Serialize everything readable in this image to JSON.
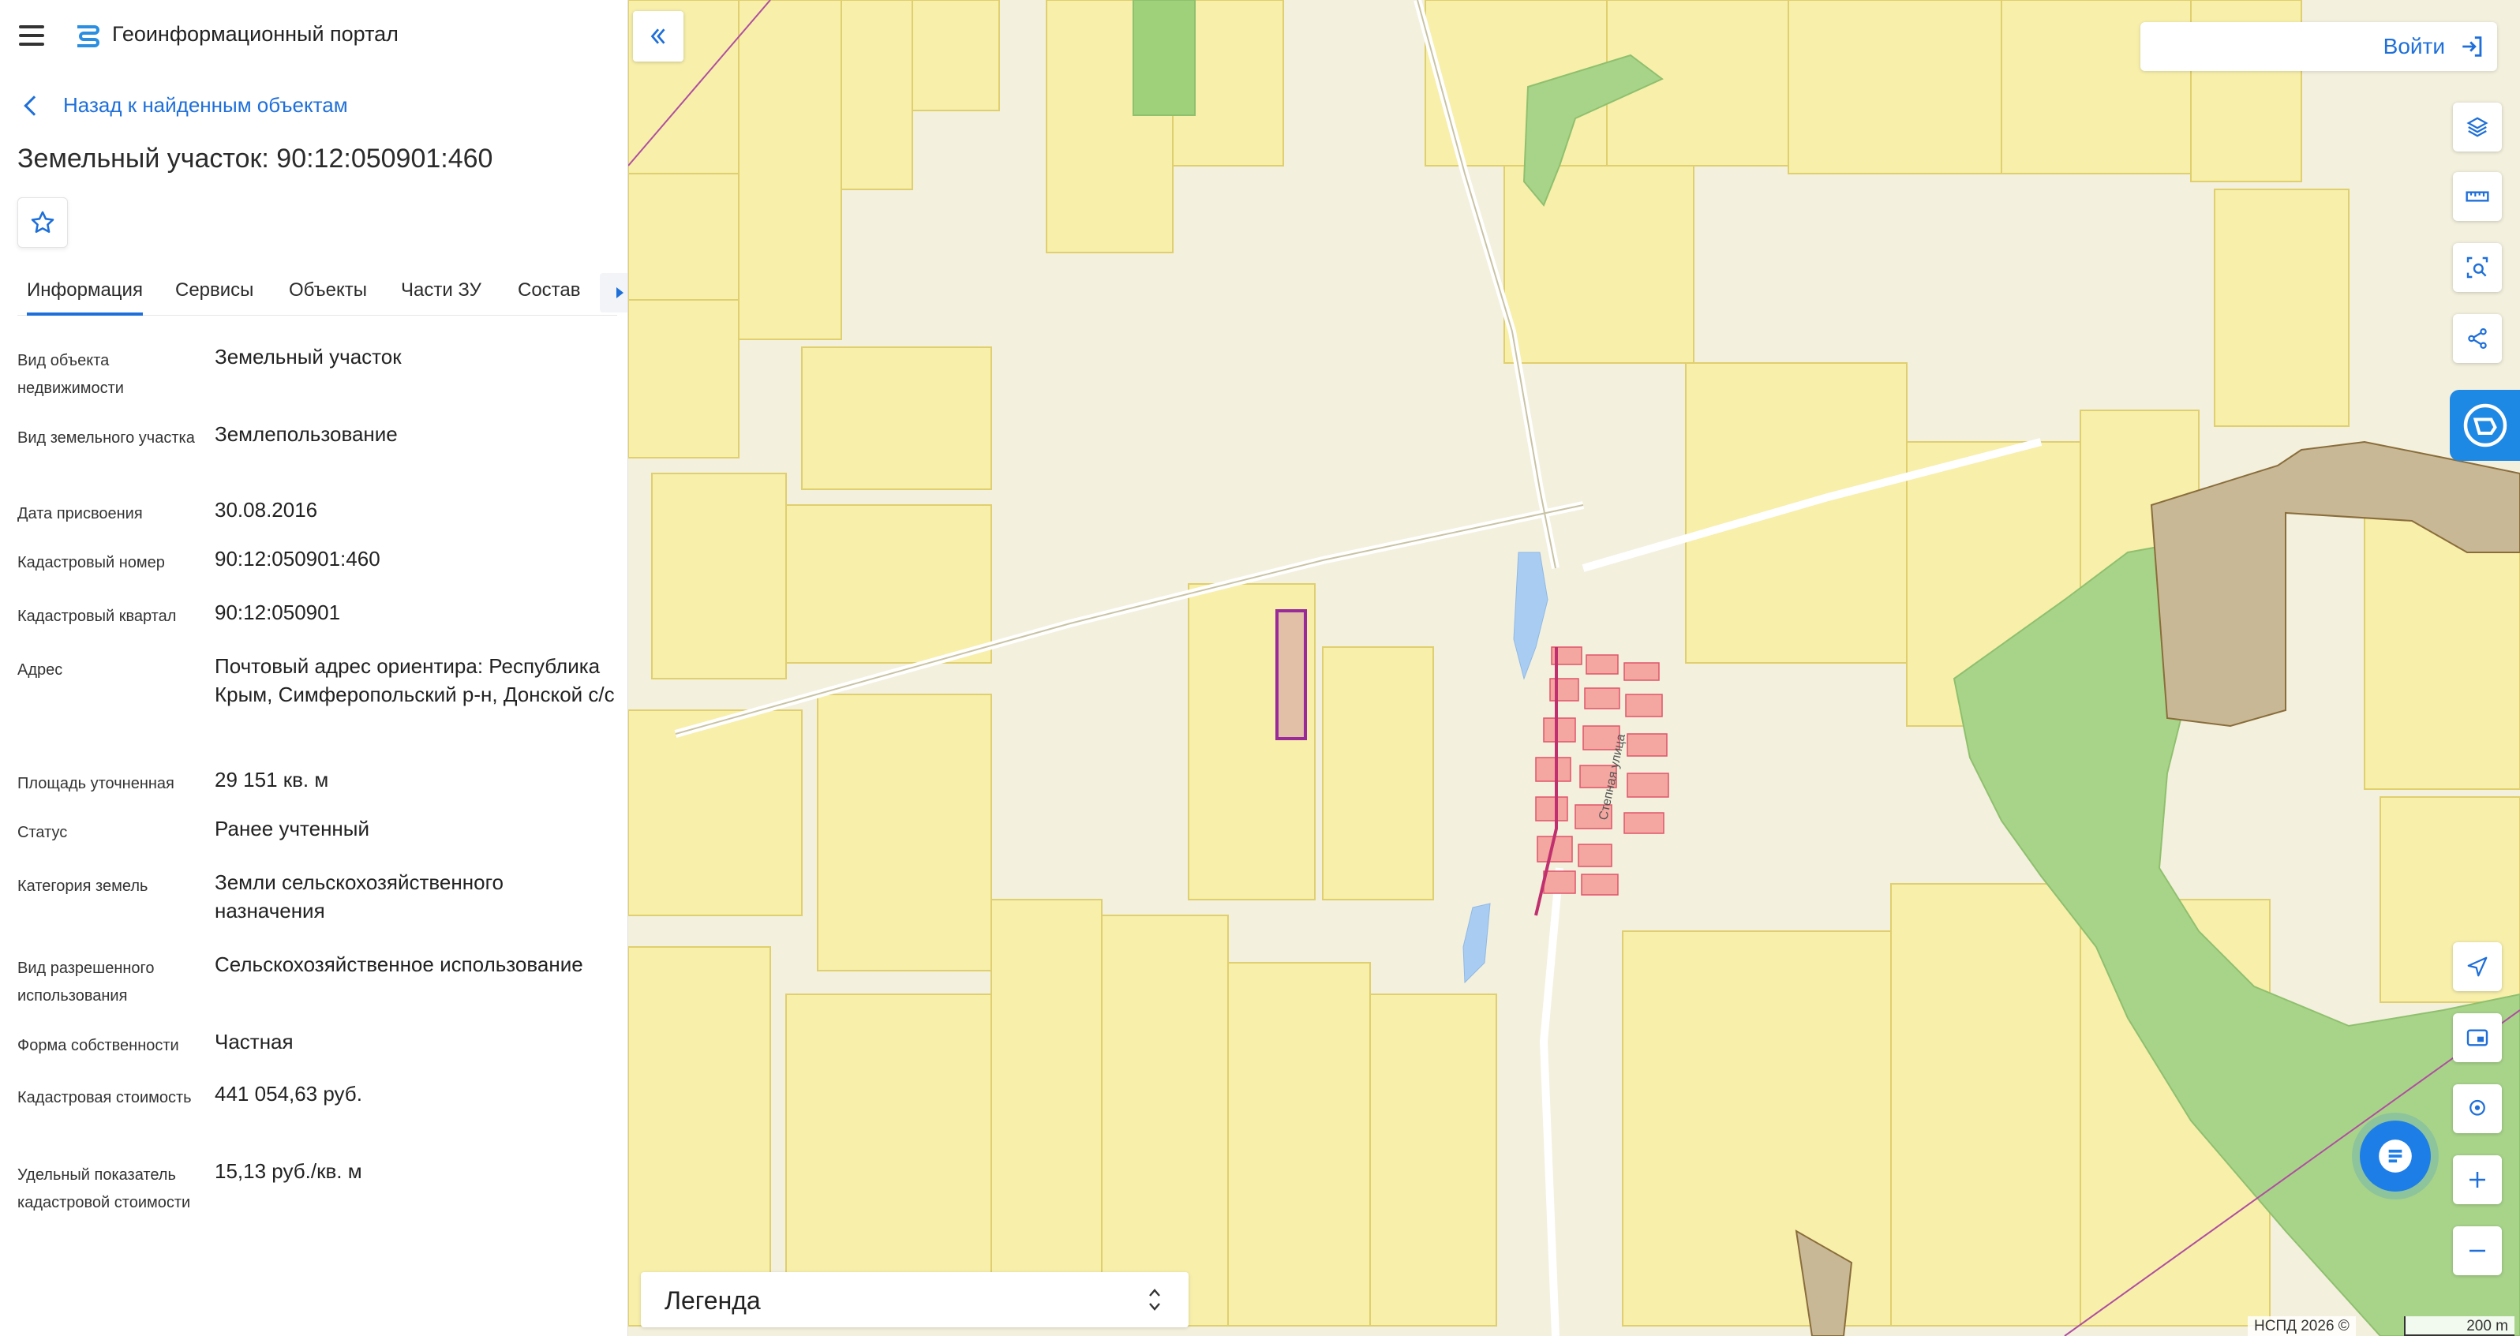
{
  "header": {
    "app_title": "Геоинформационный портал"
  },
  "nav": {
    "back_label": "Назад к найденным объектам"
  },
  "object": {
    "title": "Земельный участок: 90:12:050901:460"
  },
  "tabs": [
    {
      "label": "Информация",
      "active": true
    },
    {
      "label": "Сервисы",
      "active": false
    },
    {
      "label": "Объекты",
      "active": false
    },
    {
      "label": "Части ЗУ",
      "active": false
    },
    {
      "label": "Состав",
      "active": false
    }
  ],
  "properties": [
    {
      "key": "Вид объекта недвижимости",
      "value": "Земельный участок"
    },
    {
      "key": "Вид земельного участка",
      "value": "Землепользование"
    },
    {
      "key": "Дата присвоения",
      "value": "30.08.2016"
    },
    {
      "key": "Кадастровый номер",
      "value": "90:12:050901:460"
    },
    {
      "key": "Кадастровый квартал",
      "value": "90:12:050901"
    },
    {
      "key": "Адрес",
      "value": "Почтовый адрес ориентира: Республика Крым, Симферопольский р-н, Донской с/с"
    },
    {
      "key": "Площадь уточненная",
      "value": "29 151 кв. м"
    },
    {
      "key": "Статус",
      "value": "Ранее учтенный"
    },
    {
      "key": "Категория земель",
      "value": "Земли сельскохозяйственного назначения"
    },
    {
      "key": "Вид разрешенного использования",
      "value": "Сельскохозяйственное использование"
    },
    {
      "key": "Форма собственности",
      "value": "Частная"
    },
    {
      "key": "Кадастровая стоимость",
      "value": "441 054,63 руб."
    },
    {
      "key": "Удельный показатель кадастровой стоимости",
      "value": "15,13 руб./кв. м"
    }
  ],
  "map": {
    "login_label": "Войти",
    "legend_label": "Легенда",
    "attribution": "НСПД 2026 ©",
    "scale_label": "200 m",
    "street_label": "Степная улица",
    "tools_top": [
      "layers-icon",
      "ruler-icon",
      "area-search-icon",
      "share-icon"
    ],
    "tools_bottom": [
      "navigate-icon",
      "minimap-icon",
      "locate-icon",
      "zoom-in-icon",
      "zoom-out-icon"
    ]
  },
  "colors": {
    "accent": "#1e6fd9",
    "parcel_fill": "#f7efaa",
    "parcel_stroke": "#e0cf6e",
    "forest": "#9ccc7a",
    "selected_parcel": "#9a2a9a",
    "buildings": "#f08a8a"
  }
}
